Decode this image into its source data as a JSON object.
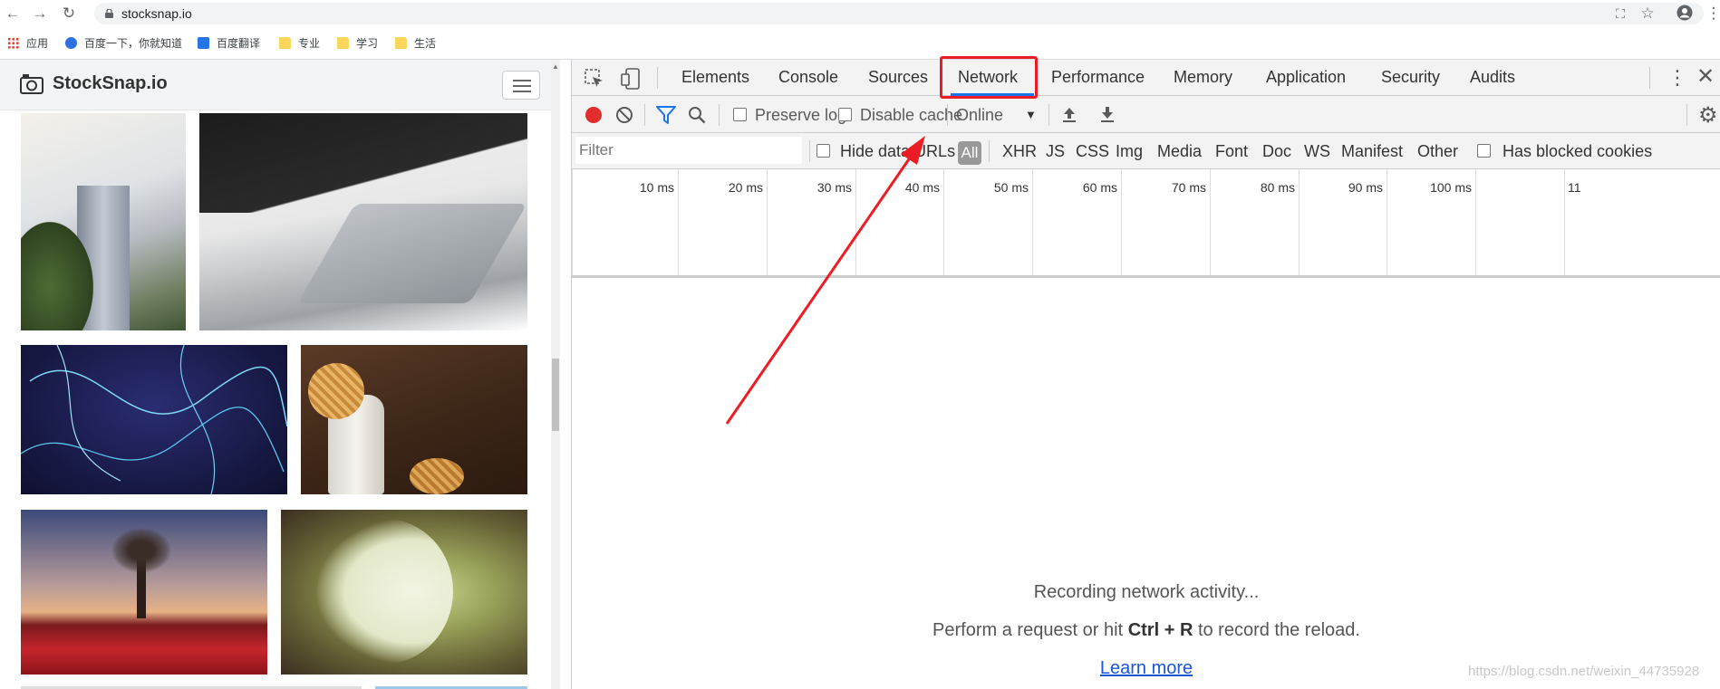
{
  "browser": {
    "url": "stocksnap.io",
    "bookmarks": [
      {
        "label": "应用",
        "icon": "apps-icon"
      },
      {
        "label": "百度一下，你就知道",
        "icon": "baidu-icon"
      },
      {
        "label": "百度翻译",
        "icon": "translate-icon"
      },
      {
        "label": "专业",
        "icon": "folder-icon"
      },
      {
        "label": "学习",
        "icon": "folder-icon"
      },
      {
        "label": "生活",
        "icon": "folder-icon"
      }
    ]
  },
  "site": {
    "logo_text": "StockSnap.io"
  },
  "devtools": {
    "tabs": [
      "Elements",
      "Console",
      "Sources",
      "Network",
      "Performance",
      "Memory",
      "Application",
      "Security",
      "Audits"
    ],
    "active_tab": "Network",
    "toolbar": {
      "preserve_log": "Preserve log",
      "disable_cache": "Disable cache",
      "throttle": "Online"
    },
    "filter": {
      "placeholder": "Filter",
      "hide_data_urls": "Hide data URLs",
      "types": [
        "All",
        "XHR",
        "JS",
        "CSS",
        "Img",
        "Media",
        "Font",
        "Doc",
        "WS",
        "Manifest",
        "Other"
      ],
      "has_blocked_cookies": "Has blocked cookies"
    },
    "timeline_ticks": [
      "10 ms",
      "20 ms",
      "30 ms",
      "40 ms",
      "50 ms",
      "60 ms",
      "70 ms",
      "80 ms",
      "90 ms",
      "100 ms",
      "11"
    ],
    "empty": {
      "line1": "Recording network activity...",
      "line2_pre": "Perform a request or hit ",
      "line2_key": "Ctrl + R",
      "line2_post": " to record the reload.",
      "learn_more": "Learn more"
    }
  },
  "watermark": "https://blog.csdn.net/weixin_44735928",
  "colors": {
    "record_red": "#e12d2d",
    "filter_blue": "#1a73e8",
    "annotation_red": "#ec1c24",
    "link_blue": "#1a56d6"
  }
}
